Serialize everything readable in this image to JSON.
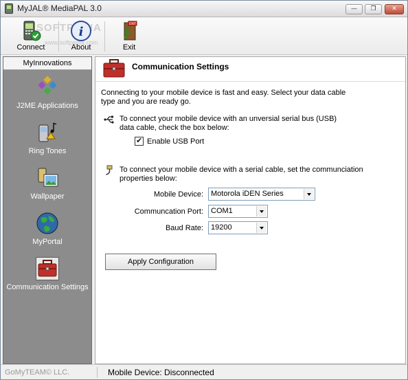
{
  "window": {
    "title": "MyJAL® MediaPAL 3.0",
    "minimize_label": "—",
    "maximize_label": "❐",
    "close_label": "✕"
  },
  "toolbar": {
    "items": [
      {
        "label": "Connect",
        "icon": "phone-connect-icon"
      },
      {
        "label": "About",
        "icon": "info-icon"
      },
      {
        "label": "Exit",
        "icon": "exit-door-icon"
      }
    ],
    "watermark": "SOFTPEDIA",
    "watermark_sub": "www.softpedia.com"
  },
  "sidebar": {
    "header": "MyInnovations",
    "items": [
      {
        "label": "J2ME Applications",
        "icon": "diamond-cluster-icon"
      },
      {
        "label": "Ring Tones",
        "icon": "phone-music-icon"
      },
      {
        "label": "Wallpaper",
        "icon": "phone-picture-icon"
      },
      {
        "label": "MyPortal",
        "icon": "globe-icon"
      },
      {
        "label": "Communication Settings",
        "icon": "toolbox-icon",
        "active": true
      }
    ]
  },
  "main": {
    "title": "Communication Settings",
    "intro_line1": "Connecting to your mobile device is fast and easy.  Select your data cable",
    "intro_line2": "type and you are ready go.",
    "usb_text_line1": "To connect your mobile device with an unversial serial bus (USB)",
    "usb_text_line2": "data cable, check the box below:",
    "usb_checkbox_label": "Enable USB Port",
    "usb_checked": true,
    "serial_text_line1": "To connect your mobile device with a serial cable, set the communciation",
    "serial_text_line2": "properties below:",
    "mobile_device_label": "Mobile Device:",
    "mobile_device_value": "Motorola iDEN Series",
    "port_label": "Communcation Port:",
    "port_value": "COM1",
    "baud_label": "Baud Rate:",
    "baud_value": "19200",
    "apply_label": "Apply Configuration"
  },
  "statusbar": {
    "company": "GoMyTEAM© LLC.",
    "status": "Mobile Device: Disconnected"
  },
  "colors": {
    "sidebar_bg": "#8c8c8c",
    "toolbox_red": "#c0302a",
    "globe_green": "#2f8a3a"
  }
}
